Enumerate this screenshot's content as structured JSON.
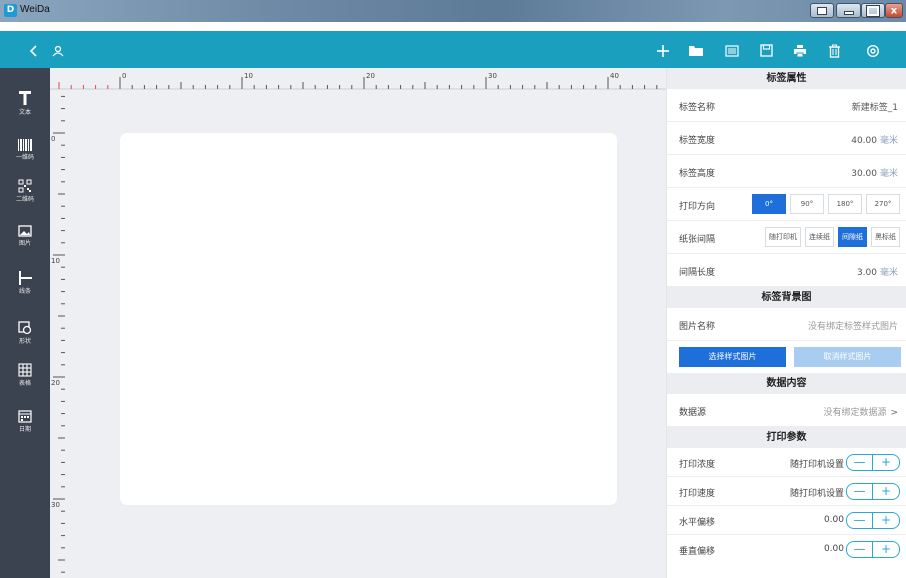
{
  "window": {
    "title": "WeiDa"
  },
  "toolbar": {
    "left_icons": [
      "back-arrow-icon",
      "user-icon"
    ],
    "right_icons": [
      "add-icon",
      "open-folder-icon",
      "list-icon",
      "save-icon",
      "print-icon",
      "delete-icon",
      "settings-icon"
    ]
  },
  "tools": [
    {
      "name": "text",
      "label": "文本"
    },
    {
      "name": "barcode",
      "label": "一维码"
    },
    {
      "name": "qrcode",
      "label": "二维码"
    },
    {
      "name": "image",
      "label": "图片"
    },
    {
      "name": "line",
      "label": "线条"
    },
    {
      "name": "shape",
      "label": "形状"
    },
    {
      "name": "table",
      "label": "表格"
    },
    {
      "name": "date",
      "label": "日期"
    }
  ],
  "ruler": {
    "h_labels": [
      "0",
      "10",
      "20",
      "30",
      "40"
    ],
    "v_labels": [
      "0",
      "10",
      "20",
      "30"
    ]
  },
  "panel": {
    "label_props": {
      "title": "标签属性",
      "name_label": "标签名称",
      "name_value": "新建标签_1",
      "width_label": "标签宽度",
      "width_value": "40.00",
      "width_unit": "毫米",
      "height_label": "标签高度",
      "height_value": "30.00",
      "height_unit": "毫米",
      "orientation_label": "打印方向",
      "orientation_options": [
        "0°",
        "90°",
        "180°",
        "270°"
      ],
      "orientation_selected": "0°",
      "gap_label": "纸张间隔",
      "gap_options": [
        "随打印机",
        "连续纸",
        "间隙纸",
        "黑标纸"
      ],
      "gap_selected": "间隙纸",
      "gap_len_label": "间隔长度",
      "gap_len_value": "3.00",
      "gap_len_unit": "毫米"
    },
    "background": {
      "title": "标签背景图",
      "image_label": "图片名称",
      "image_value": "没有绑定标签样式图片",
      "select_btn": "选择样式图片",
      "cancel_btn": "取消样式图片"
    },
    "data": {
      "title": "数据内容",
      "source_label": "数据源",
      "source_value": "没有绑定数据源"
    },
    "print": {
      "title": "打印参数",
      "density_label": "打印浓度",
      "density_value": "随打印机设置",
      "speed_label": "打印速度",
      "speed_value": "随打印机设置",
      "hoffset_label": "水平偏移",
      "hoffset_value": "0.00",
      "voffset_label": "垂直偏移",
      "voffset_value": "0.00",
      "minus": "—",
      "plus": "+"
    }
  },
  "colors": {
    "toolbar": "#1a9fbf",
    "leftbar": "#3c4350",
    "accent": "#1e6fd9",
    "stepper": "#29a9d4"
  }
}
